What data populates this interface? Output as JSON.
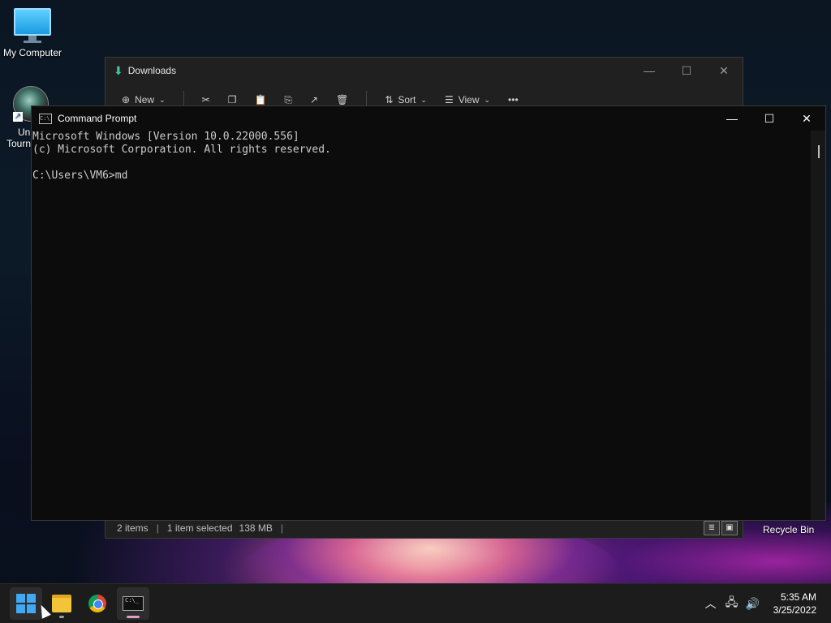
{
  "desktop": {
    "icons": [
      {
        "label": "My Computer",
        "icon": "monitor-icon"
      },
      {
        "label_line1": "Un",
        "label_line2": "Tourn",
        "icon": "game-shortcut-icon"
      }
    ],
    "recycle_bin_label": "Recycle Bin"
  },
  "explorer": {
    "title": "Downloads",
    "toolbar": {
      "new_label": "New",
      "sort_label": "Sort",
      "view_label": "View",
      "more_label": "•••"
    },
    "status": {
      "items": "2 items",
      "selected": "1 item selected",
      "size": "138 MB"
    }
  },
  "cmd": {
    "title": "Command Prompt",
    "lines": [
      "Microsoft Windows [Version 10.0.22000.556]",
      "(c) Microsoft Corporation. All rights reserved.",
      "",
      "C:\\Users\\VM6>md"
    ]
  },
  "taskbar": {
    "apps": [
      {
        "name": "Start",
        "icon": "windows-logo-icon"
      },
      {
        "name": "File Explorer",
        "icon": "folder-icon"
      },
      {
        "name": "Google Chrome",
        "icon": "chrome-icon"
      },
      {
        "name": "Command Prompt",
        "icon": "terminal-icon"
      }
    ],
    "clock": {
      "time": "5:35 AM",
      "date": "3/25/2022"
    }
  },
  "colors": {
    "accent": "#3fa9f5",
    "terminal_bg": "#0c0c0c",
    "terminal_text": "#cccccc"
  }
}
